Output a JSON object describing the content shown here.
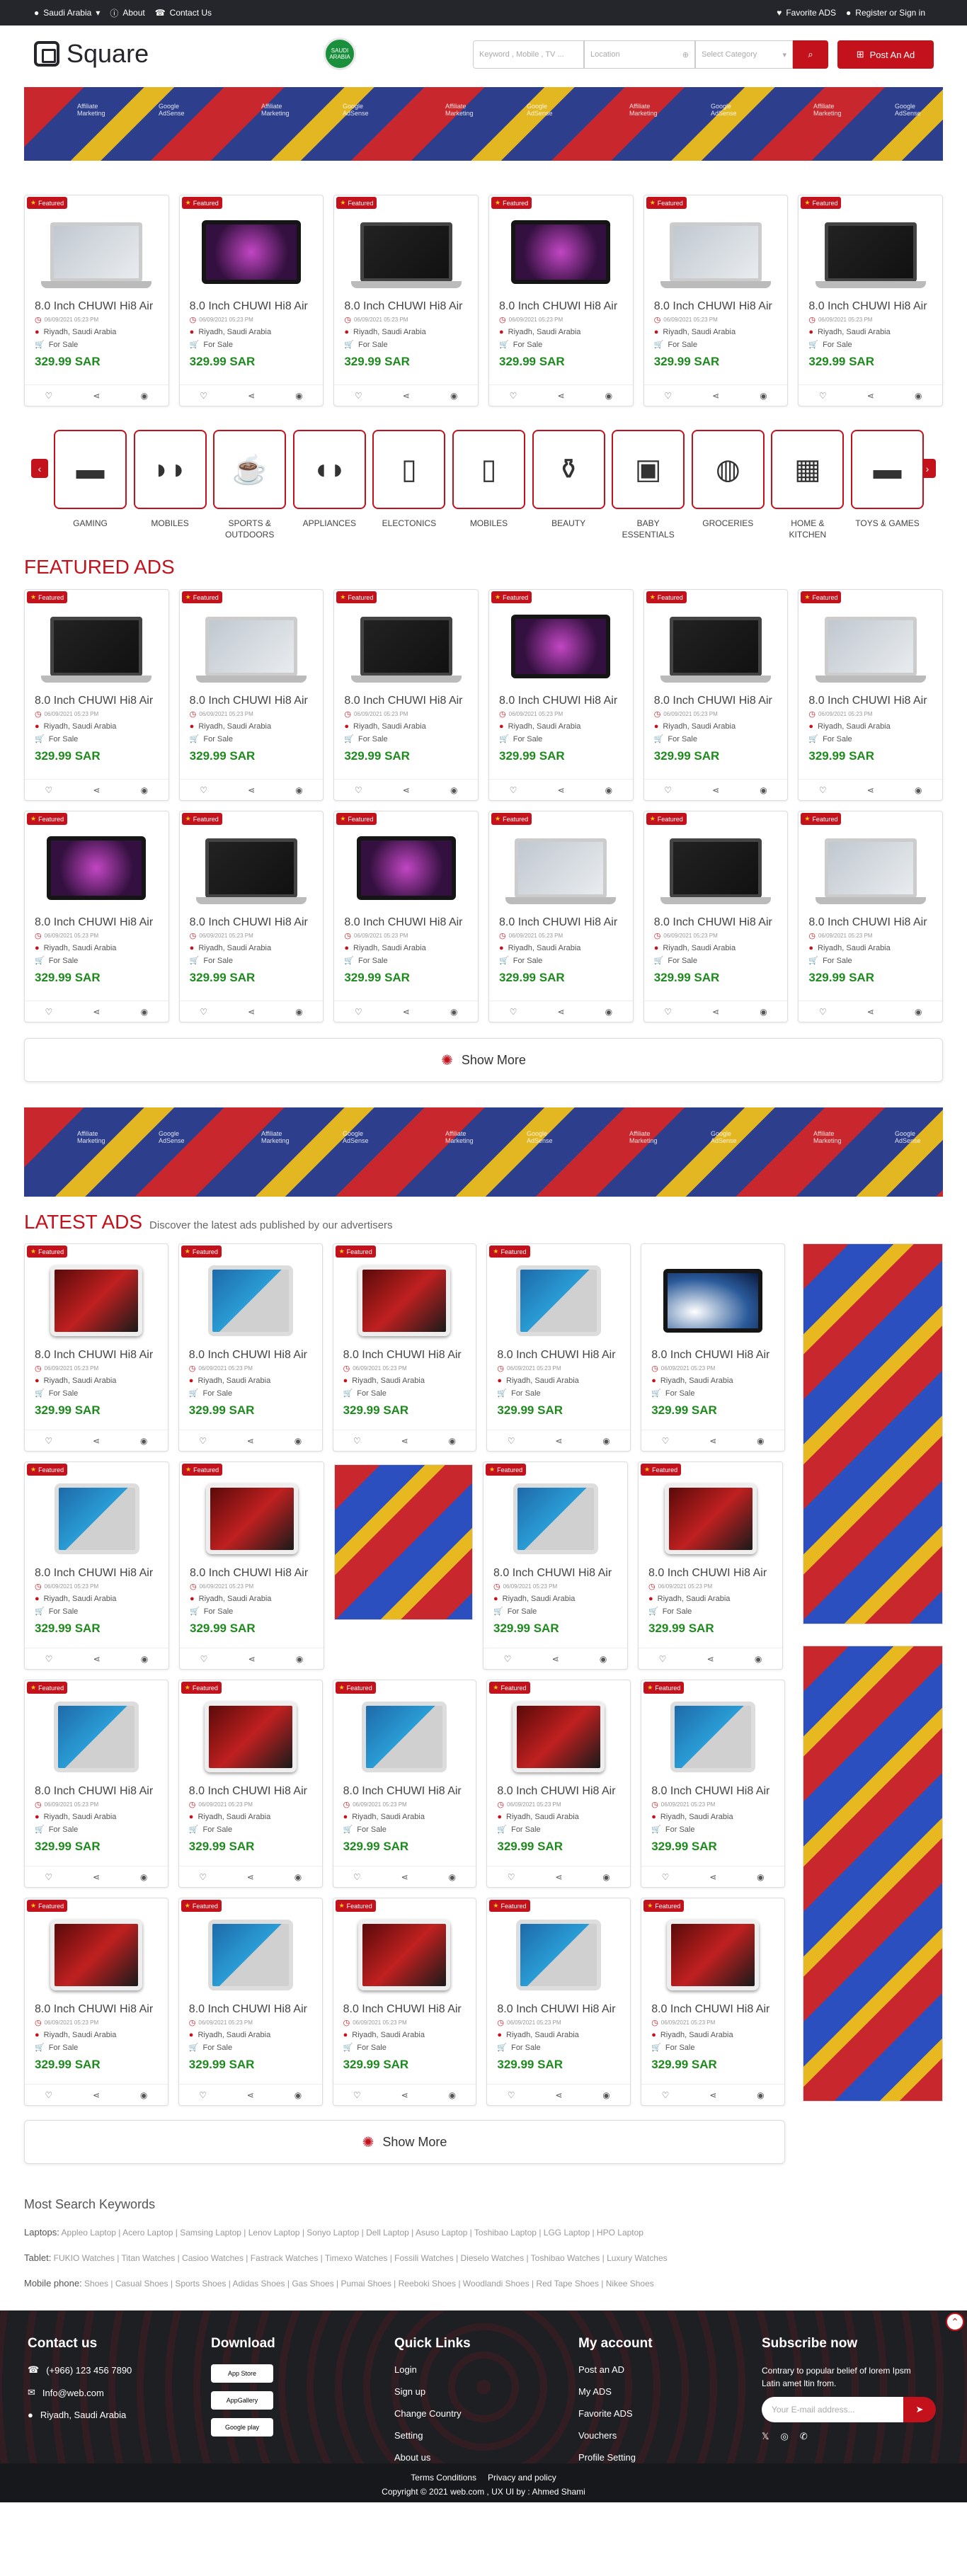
{
  "topbar": {
    "country": "Saudi Arabia",
    "about": "About",
    "contact": "Contact Us",
    "favorites": "Favorite ADS",
    "register": "Register or Sign in"
  },
  "header": {
    "logo": "Square",
    "search_placeholder": "Keyword , Mobile , TV ...",
    "location_placeholder": "Location",
    "category_placeholder": "Select Category",
    "post_ad": "Post An Ad",
    "flag_text": "SAUDI ARABIA"
  },
  "banner": {
    "label1": "Affiliate Marketing",
    "label2": "Google AdSense"
  },
  "card": {
    "title": "8.0 Inch CHUWI Hi8 Air",
    "date": "06/09/2021 05:23 PM",
    "location": "Riyadh, Saudi Arabia",
    "status": "For Sale",
    "price": "329.99 SAR",
    "badge": "Featured"
  },
  "categories": [
    "GAMING",
    "MOBILES",
    "SPORTS & OUTDOORS",
    "APPLIANCES",
    "ELECTONICS",
    "MOBILES",
    "BEAUTY",
    "BABY ESSENTIALS",
    "GROCERIES",
    "HOME & KITCHEN",
    "TOYS & GAMES"
  ],
  "featured": {
    "title": "FEATURED ADS"
  },
  "latest": {
    "title": "LATEST ADS",
    "subtitle": "Discover the latest ads published by our advertisers"
  },
  "show_more": "Show More",
  "keywords": {
    "title": "Most Search Keywords",
    "laptops_label": "Laptops:",
    "laptops": "Appleo Laptop | Acero Laptop | Samsing Laptop | Lenov Laptop | Sonyo Laptop | Dell Laptop | Asuso Laptop | Toshibao Laptop | LGG Laptop | HPO Laptop",
    "tablets_label": "Tablet:",
    "tablets": "FUKIO Watches | Titan Watches | Casioo Watches | Fastrack Watches | Timexo Watches | Fossili Watches | Dieselo Watches | Toshibao Watches | Luxury Watches",
    "mobile_label": "Mobile phone:",
    "mobile": "Shoes | Casual Shoes | Sports Shoes | Adidas Shoes | Gas Shoes | Pumai Shoes | Reeboki Shoes | Woodlandi Shoes | Red Tape Shoes | Nikee Shoes"
  },
  "footer": {
    "contact_title": "Contact us",
    "phone": "(+966) 123 456 7890",
    "email": "Info@web.com",
    "address": "Riyadh, Saudi Arabia",
    "download_title": "Download",
    "app_store": "App Store",
    "app_gallery": "AppGallery",
    "google_play": "Google play",
    "quick_title": "Quick Links",
    "quick": [
      "Login",
      "Sign up",
      "Change Country",
      "Setting",
      "About us"
    ],
    "account_title": "My account",
    "account": [
      "Post an AD",
      "My ADS",
      "Favorite ADS",
      "Vouchers",
      "Profile Setting"
    ],
    "subscribe_title": "Subscribe now",
    "subscribe_text": "Contrary to popular belief of lorem Ipsm Latin amet ltin from.",
    "email_placeholder": "Your E-mail address...",
    "terms": "Terms Conditions",
    "privacy": "Privacy and policy",
    "copyright": "Copyright © 2021 web.com , UX UI by : Ahmed Shami"
  }
}
